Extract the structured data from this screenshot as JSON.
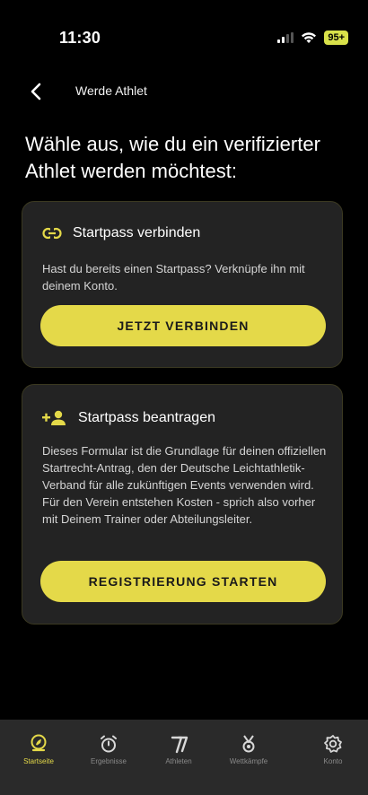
{
  "status_bar": {
    "time": "11:30",
    "battery": "95+"
  },
  "header": {
    "title": "Werde Athlet"
  },
  "heading": "Wähle aus, wie du ein verifizierter Athlet werden möchtest:",
  "cards": [
    {
      "icon": "link-icon",
      "title": "Startpass verbinden",
      "text": "Hast du bereits einen Startpass? Verknüpfe ihn mit deinem Konto.",
      "button": "JETZT VERBINDEN"
    },
    {
      "icon": "add-person-icon",
      "title": "Startpass beantragen",
      "text": "Dieses Formular ist die Grundlage für deinen offiziellen Startrecht-Antrag, den der Deutsche Leichtathletik-Verband für alle zukünftigen Events verwenden wird. Für den Verein entstehen Kosten - sprich also vorher mit Deinem Trainer oder Abteilungsleiter.",
      "button": "REGISTRIERUNG STARTEN"
    }
  ],
  "tabs": [
    {
      "label": "Startseite",
      "icon": "home-badge-icon",
      "active": true
    },
    {
      "label": "Ergebnisse",
      "icon": "stopwatch-icon",
      "active": false
    },
    {
      "label": "Athleten",
      "icon": "athletes-icon",
      "active": false
    },
    {
      "label": "Wettkämpfe",
      "icon": "medal-icon",
      "active": false
    },
    {
      "label": "Konto",
      "icon": "gear-icon",
      "active": false
    }
  ],
  "colors": {
    "accent": "#e4d949",
    "background": "#000000",
    "card": "#232323",
    "tab_bar": "#2a2a2a"
  }
}
